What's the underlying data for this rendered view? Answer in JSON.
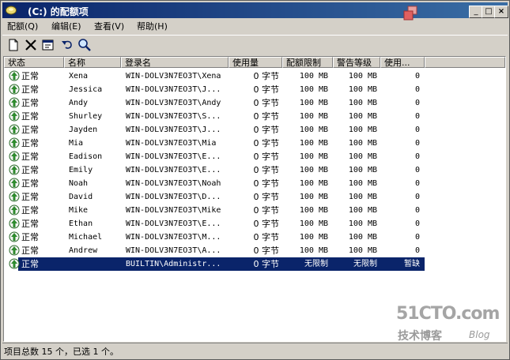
{
  "window": {
    "title": "(C:) 的配额项",
    "minimize": "_",
    "maximize": "□",
    "close": "×"
  },
  "menu": [
    {
      "label": "配额(Q)"
    },
    {
      "label": "编辑(E)"
    },
    {
      "label": "查看(V)"
    },
    {
      "label": "帮助(H)"
    }
  ],
  "toolbar": [
    {
      "icon": "new-entry-icon"
    },
    {
      "icon": "delete-icon"
    },
    {
      "icon": "properties-icon"
    },
    {
      "icon": "undo-icon"
    },
    {
      "icon": "find-icon"
    }
  ],
  "columns": [
    "状态",
    "名称",
    "登录名",
    "使用量",
    "配额限制",
    "警告等级",
    "使用..."
  ],
  "rows": [
    {
      "status": "正常",
      "name": "Xena",
      "login": "WIN-DOLV3N7EO3T\\Xena",
      "used": "0 字节",
      "limit": "100 MB",
      "warn": "100 MB",
      "pct": "0"
    },
    {
      "status": "正常",
      "name": "Jessica",
      "login": "WIN-DOLV3N7EO3T\\J...",
      "used": "0 字节",
      "limit": "100 MB",
      "warn": "100 MB",
      "pct": "0"
    },
    {
      "status": "正常",
      "name": "Andy",
      "login": "WIN-DOLV3N7EO3T\\Andy",
      "used": "0 字节",
      "limit": "100 MB",
      "warn": "100 MB",
      "pct": "0"
    },
    {
      "status": "正常",
      "name": "Shurley",
      "login": "WIN-DOLV3N7EO3T\\S...",
      "used": "0 字节",
      "limit": "100 MB",
      "warn": "100 MB",
      "pct": "0"
    },
    {
      "status": "正常",
      "name": "Jayden",
      "login": "WIN-DOLV3N7EO3T\\J...",
      "used": "0 字节",
      "limit": "100 MB",
      "warn": "100 MB",
      "pct": "0"
    },
    {
      "status": "正常",
      "name": "Mia",
      "login": "WIN-DOLV3N7EO3T\\Mia",
      "used": "0 字节",
      "limit": "100 MB",
      "warn": "100 MB",
      "pct": "0"
    },
    {
      "status": "正常",
      "name": "Eadison",
      "login": "WIN-DOLV3N7EO3T\\E...",
      "used": "0 字节",
      "limit": "100 MB",
      "warn": "100 MB",
      "pct": "0"
    },
    {
      "status": "正常",
      "name": "Emily",
      "login": "WIN-DOLV3N7EO3T\\E...",
      "used": "0 字节",
      "limit": "100 MB",
      "warn": "100 MB",
      "pct": "0"
    },
    {
      "status": "正常",
      "name": "Noah",
      "login": "WIN-DOLV3N7EO3T\\Noah",
      "used": "0 字节",
      "limit": "100 MB",
      "warn": "100 MB",
      "pct": "0"
    },
    {
      "status": "正常",
      "name": "David",
      "login": "WIN-DOLV3N7EO3T\\D...",
      "used": "0 字节",
      "limit": "100 MB",
      "warn": "100 MB",
      "pct": "0"
    },
    {
      "status": "正常",
      "name": "Mike",
      "login": "WIN-DOLV3N7EO3T\\Mike",
      "used": "0 字节",
      "limit": "100 MB",
      "warn": "100 MB",
      "pct": "0"
    },
    {
      "status": "正常",
      "name": "Ethan",
      "login": "WIN-DOLV3N7EO3T\\E...",
      "used": "0 字节",
      "limit": "100 MB",
      "warn": "100 MB",
      "pct": "0"
    },
    {
      "status": "正常",
      "name": "Michael",
      "login": "WIN-DOLV3N7EO3T\\M...",
      "used": "0 字节",
      "limit": "100 MB",
      "warn": "100 MB",
      "pct": "0"
    },
    {
      "status": "正常",
      "name": "Andrew",
      "login": "WIN-DOLV3N7EO3T\\A...",
      "used": "0 字节",
      "limit": "100 MB",
      "warn": "100 MB",
      "pct": "0"
    },
    {
      "status": "正常",
      "name": "",
      "login": "BUILTIN\\Administr...",
      "used": "0 字节",
      "limit": "无限制",
      "warn": "无限制",
      "pct": "暂缺"
    }
  ],
  "selected_row": 14,
  "statusbar": {
    "text": "项目总数 15 个，已选 1 个。"
  },
  "watermark": {
    "main": "51CTO.com",
    "sub": "技术博客",
    "blog": "Blog"
  },
  "colors": {
    "title_start": "#0a246a",
    "title_end": "#3a6ea5",
    "selection": "#0a246a"
  }
}
